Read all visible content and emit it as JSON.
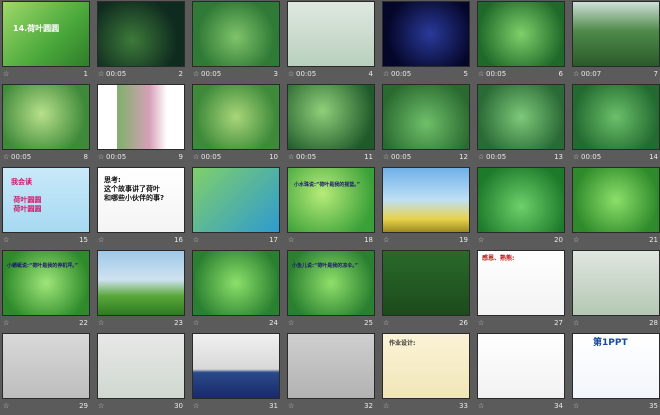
{
  "slides": [
    {
      "n": "1",
      "time": "",
      "bg": "linear-gradient(135deg,#9fd86a 0%,#4aa83a 60%,#2f7d2a 100%)",
      "caption": "14.荷叶圆圆",
      "capColor": "#ffffff",
      "capSize": 8,
      "capX": 10,
      "capY": 22
    },
    {
      "n": "2",
      "time": "00:05",
      "bg": "radial-gradient(circle at 40% 60%,#3d7a3a,#0f2b1f 70%)",
      "caption": "",
      "capColor": "#fff",
      "capSize": 7,
      "capX": 0,
      "capY": 0
    },
    {
      "n": "3",
      "time": "00:05",
      "bg": "radial-gradient(circle at 50% 55%,#7fc36a,#2f7a36 70%)",
      "caption": "",
      "capColor": "#fff",
      "capSize": 7,
      "capX": 0,
      "capY": 0
    },
    {
      "n": "4",
      "time": "00:05",
      "bg": "linear-gradient(180deg,#dfe8e0,#b9d0bd)",
      "caption": "",
      "capColor": "#fff",
      "capSize": 7,
      "capX": 0,
      "capY": 0
    },
    {
      "n": "5",
      "time": "00:05",
      "bg": "radial-gradient(circle at 55% 50%,#2a3a9a,#05072a 75%)",
      "caption": "",
      "capColor": "#fff",
      "capSize": 7,
      "capX": 0,
      "capY": 0
    },
    {
      "n": "6",
      "time": "00:05",
      "bg": "radial-gradient(circle at 50% 50%,#7fd06a,#1f6a2a 80%)",
      "caption": "",
      "capColor": "#fff",
      "capSize": 7,
      "capX": 0,
      "capY": 0
    },
    {
      "n": "7",
      "time": "00:07",
      "bg": "linear-gradient(180deg,#cfe0d8 0%,#4f8a4a 45%,#2b5a2a 100%)",
      "caption": "",
      "capColor": "#fff",
      "capSize": 7,
      "capX": 0,
      "capY": 0
    },
    {
      "n": "8",
      "time": "00:05",
      "bg": "radial-gradient(circle at 45% 45%,#b8e08a,#3f8a3a 75%)",
      "caption": "",
      "capColor": "#fff",
      "capSize": 7,
      "capX": 0,
      "capY": 0
    },
    {
      "n": "9",
      "time": "00:05",
      "bg": "linear-gradient(90deg,#ffffff 0%,#ffffff 22%,#7fb06a 22%,#d6a0b8 60%,#ffffff 80%)",
      "caption": "",
      "capColor": "#fff",
      "capSize": 7,
      "capX": 0,
      "capY": 0
    },
    {
      "n": "10",
      "time": "00:05",
      "bg": "radial-gradient(circle at 50% 50%,#a9d67a,#3e8a3a 75%)",
      "caption": "",
      "capColor": "#fff",
      "capSize": 7,
      "capX": 0,
      "capY": 0
    },
    {
      "n": "11",
      "time": "00:05",
      "bg": "radial-gradient(circle at 40% 40%,#8fd07a,#1f5a2a 80%)",
      "caption": "",
      "capColor": "#fff",
      "capSize": 7,
      "capX": 0,
      "capY": 0
    },
    {
      "n": "12",
      "time": "00:05",
      "bg": "radial-gradient(circle at 50% 60%,#6fc06a,#2a6a30 80%)",
      "caption": "",
      "capColor": "#fff",
      "capSize": 7,
      "capX": 0,
      "capY": 0
    },
    {
      "n": "13",
      "time": "00:05",
      "bg": "radial-gradient(circle at 50% 50%,#7ec97a,#2a6a36 80%)",
      "caption": "",
      "capColor": "#fff",
      "capSize": 7,
      "capX": 0,
      "capY": 0
    },
    {
      "n": "14",
      "time": "00:05",
      "bg": "radial-gradient(circle at 50% 50%,#6cc06a,#226a30 80%)",
      "caption": "",
      "capColor": "#fff",
      "capSize": 7,
      "capX": 0,
      "capY": 0
    },
    {
      "n": "15",
      "time": "",
      "bg": "linear-gradient(180deg,#c9e9f9,#a6d9f2)",
      "caption": "我会读\n\n 荷叶圆圆\n 荷叶圆圆",
      "capColor": "#d01a6a",
      "capSize": 7,
      "capX": 8,
      "capY": 10
    },
    {
      "n": "16",
      "time": "",
      "bg": "linear-gradient(180deg,#ffffff,#f4f4f4)",
      "caption": "思考:\n这个故事讲了荷叶\n和哪些小伙伴的事?",
      "capColor": "#111111",
      "capSize": 7,
      "capX": 6,
      "capY": 8
    },
    {
      "n": "17",
      "time": "",
      "bg": "linear-gradient(135deg,#7fd06a,#2f9ad0)",
      "caption": "",
      "capColor": "#fff",
      "capSize": 7,
      "capX": 0,
      "capY": 0
    },
    {
      "n": "18",
      "time": "",
      "bg": "radial-gradient(circle at 40% 40%,#b7ec7a,#3aa038 80%)",
      "caption": "小水珠说:“荷叶是我的摇篮。”",
      "capColor": "#1a1a6a",
      "capSize": 5,
      "capX": 6,
      "capY": 14
    },
    {
      "n": "19",
      "time": "",
      "bg": "linear-gradient(180deg,#6fb0e8 0%,#bfe0f5 50%,#e8d24a 80%,#9a8a20 100%)",
      "caption": "",
      "capColor": "#fff",
      "capSize": 7,
      "capX": 0,
      "capY": 0
    },
    {
      "n": "20",
      "time": "",
      "bg": "radial-gradient(circle at 50% 60%,#6dd06a,#1c7a2a 80%)",
      "caption": "",
      "capColor": "#e01a1a",
      "capSize": 7,
      "capX": 30,
      "capY": 10
    },
    {
      "n": "21",
      "time": "",
      "bg": "radial-gradient(circle at 50% 50%,#8ce06a,#2e8a2a 80%)",
      "caption": "",
      "capColor": "#e01a1a",
      "capSize": 7,
      "capX": 0,
      "capY": 0
    },
    {
      "n": "22",
      "time": "",
      "bg": "radial-gradient(circle at 50% 50%,#9fe67a,#2e8a2a 80%)",
      "caption": "小蜻蜓说:“荷叶是我的停机坪。”",
      "capColor": "#1a1a6a",
      "capSize": 5,
      "capX": 4,
      "capY": 12
    },
    {
      "n": "23",
      "time": "",
      "bg": "linear-gradient(180deg,#9fc8e8 0%,#cfe2f0 45%,#5aa83a 70%,#2e7a22 100%)",
      "caption": "",
      "capColor": "#fff",
      "capSize": 7,
      "capX": 0,
      "capY": 0
    },
    {
      "n": "24",
      "time": "",
      "bg": "radial-gradient(circle at 50% 50%,#8ce06a,#2a8030 80%)",
      "caption": "",
      "capColor": "#fff",
      "capSize": 7,
      "capX": 0,
      "capY": 0
    },
    {
      "n": "25",
      "time": "",
      "bg": "radial-gradient(circle at 50% 50%,#8fe06a,#2a8030 80%)",
      "caption": "小鱼儿说:“荷叶是我的凉伞。”",
      "capColor": "#1a1a6a",
      "capSize": 5,
      "capX": 4,
      "capY": 12
    },
    {
      "n": "26",
      "time": "",
      "bg": "linear-gradient(180deg,#2a6a2a,#1c4a1c)",
      "caption": "",
      "capColor": "#ffffff",
      "capSize": 5,
      "capX": 0,
      "capY": 0
    },
    {
      "n": "27",
      "time": "",
      "bg": "linear-gradient(180deg,#ffffff,#f3f3f3)",
      "caption": "感恩、熟熊:",
      "capColor": "#c01a1a",
      "capSize": 6,
      "capX": 4,
      "capY": 4
    },
    {
      "n": "28",
      "time": "",
      "bg": "linear-gradient(180deg,#e0e6e0,#b4c8b4)",
      "caption": "",
      "capColor": "#fff",
      "capSize": 7,
      "capX": 0,
      "capY": 0
    },
    {
      "n": "29",
      "time": "",
      "bg": "linear-gradient(180deg,#d9d9d9,#bdbdbd)",
      "caption": "",
      "capColor": "#fff",
      "capSize": 7,
      "capX": 0,
      "capY": 0
    },
    {
      "n": "30",
      "time": "",
      "bg": "linear-gradient(180deg,#e8e8e8,#cfd8cf)",
      "caption": "",
      "capColor": "#fff",
      "capSize": 7,
      "capX": 0,
      "capY": 0
    },
    {
      "n": "31",
      "time": "",
      "bg": "linear-gradient(180deg,#f0f0f0 0%,#d8d8d8 55%,#2a4a8a 60%,#1a2a6a 100%)",
      "caption": "",
      "capColor": "#fff",
      "capSize": 7,
      "capX": 0,
      "capY": 0
    },
    {
      "n": "32",
      "time": "",
      "bg": "linear-gradient(180deg,#cfcfcf,#b2b2b2)",
      "caption": "",
      "capColor": "#fff",
      "capSize": 7,
      "capX": 0,
      "capY": 0
    },
    {
      "n": "33",
      "time": "",
      "bg": "linear-gradient(180deg,#fbf3d6,#f1e6b8)",
      "caption": "作业设计:",
      "capColor": "#333333",
      "capSize": 6,
      "capX": 6,
      "capY": 6
    },
    {
      "n": "34",
      "time": "",
      "bg": "linear-gradient(180deg,#ffffff,#f2f2f2)",
      "caption": "",
      "capColor": "#e01a1a",
      "capSize": 7,
      "capX": 0,
      "capY": 0
    },
    {
      "n": "35",
      "time": "",
      "bg": "linear-gradient(180deg,#ffffff,#f2f6fb)",
      "caption": "第1PPT",
      "capColor": "#1a4aa0",
      "capSize": 9,
      "capX": 20,
      "capY": 4
    }
  ],
  "icons": {
    "slide_star": "star-icon"
  }
}
